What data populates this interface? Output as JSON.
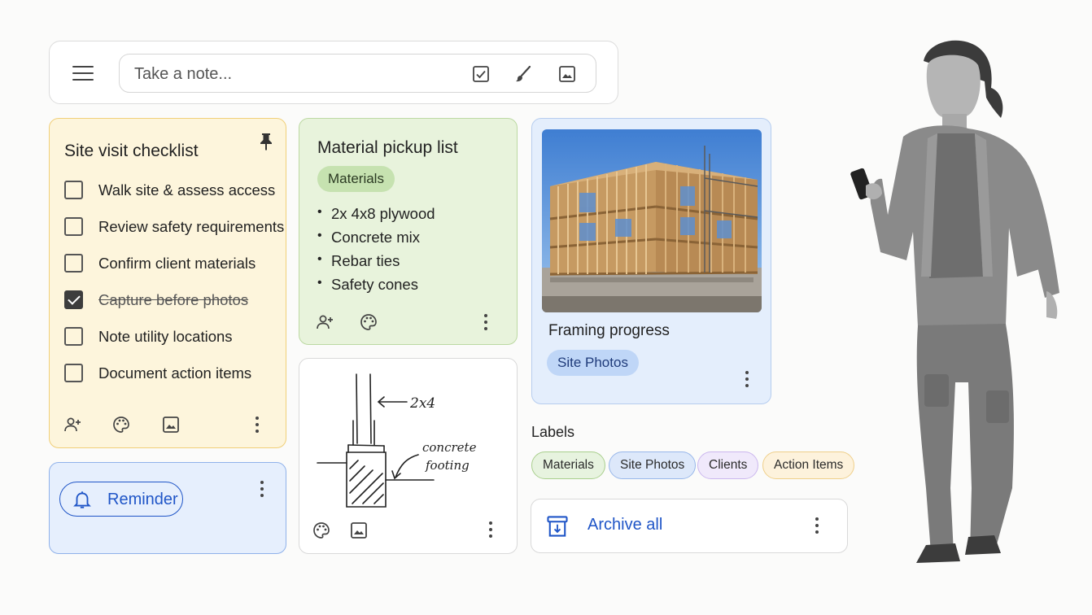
{
  "search": {
    "placeholder": "Take a note..."
  },
  "toolbar": {
    "icons": [
      "hamburger-menu-icon",
      "checkbox-icon",
      "brush-icon",
      "image-icon"
    ]
  },
  "checklist_card": {
    "title": "Site visit checklist",
    "pinned": true,
    "items": [
      {
        "label": "Walk site & assess access",
        "checked": false
      },
      {
        "label": "Review safety requirements",
        "checked": false
      },
      {
        "label": "Confirm client materials",
        "checked": false
      },
      {
        "label": "Capture before photos",
        "checked": true
      },
      {
        "label": "Note utility locations",
        "checked": false
      },
      {
        "label": "Document action items",
        "checked": false
      }
    ],
    "color": "#fdf5dc"
  },
  "material_card": {
    "title": "Material pickup list",
    "label": "Materials",
    "items": [
      "2x 4x8 plywood",
      "Concrete mix",
      "Rebar ties",
      "Safety cones"
    ],
    "color": "#e8f3dc"
  },
  "photo_card": {
    "title": "Framing progress",
    "label": "Site Photos",
    "color": "#e4eefc"
  },
  "reminder_card": {
    "button_label": "Reminder"
  },
  "sketch_card": {
    "annotation_1": "2x4",
    "annotation_2_line1": "concrete",
    "annotation_2_line2": "footing"
  },
  "labels": {
    "heading": "Labels",
    "items": [
      "Materials",
      "Site Photos",
      "Clients",
      "Action Items"
    ]
  },
  "archive": {
    "label": "Archive all"
  },
  "colors": {
    "accent_blue": "#1f55c7",
    "yellow_border": "#f0cf78",
    "green_chip": "#c6e2b0",
    "blue_chip": "#bfd6f7"
  }
}
